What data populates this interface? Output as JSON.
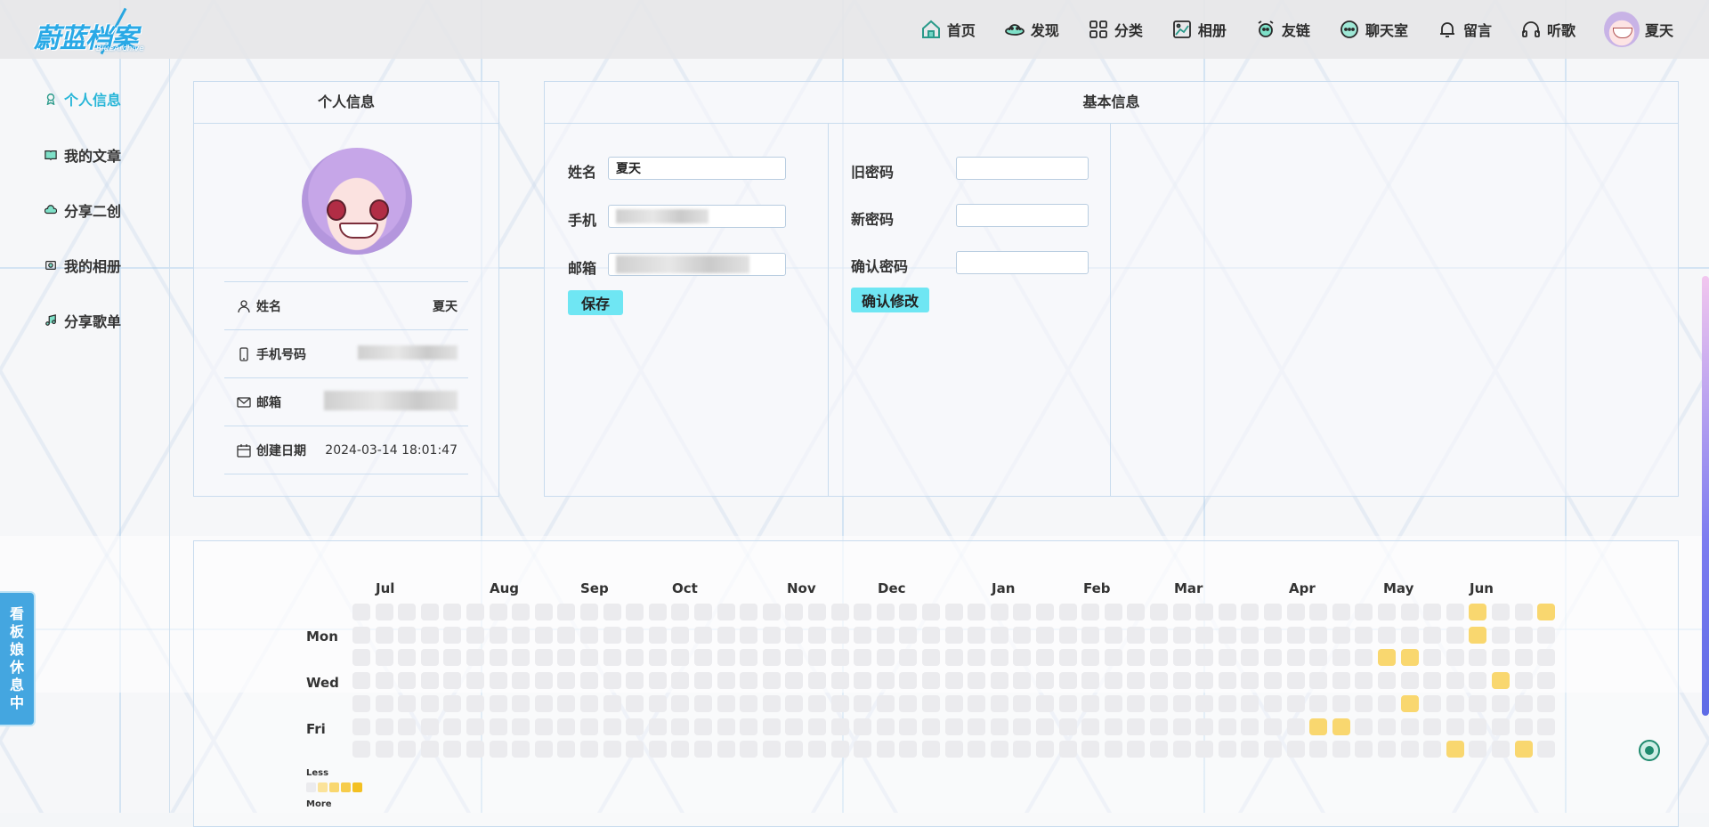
{
  "app": {
    "logo_main": "蔚蓝档案",
    "logo_sub": "BlueArchive"
  },
  "nav": {
    "items": [
      {
        "label": "首页",
        "icon": "home-icon"
      },
      {
        "label": "发现",
        "icon": "ufo-icon"
      },
      {
        "label": "分类",
        "icon": "grid-icon"
      },
      {
        "label": "相册",
        "icon": "image-icon"
      },
      {
        "label": "友链",
        "icon": "alarm-clock-icon"
      },
      {
        "label": "聊天室",
        "icon": "chat-icon"
      },
      {
        "label": "留言",
        "icon": "bell-icon"
      },
      {
        "label": "听歌",
        "icon": "headphones-icon"
      }
    ],
    "user_name": "夏天"
  },
  "sidebar": {
    "items": [
      {
        "label": "个人信息",
        "active": true,
        "icon": "user-badge-icon"
      },
      {
        "label": "我的文章",
        "active": false,
        "icon": "book-icon"
      },
      {
        "label": "分享二创",
        "active": false,
        "icon": "cloud-icon"
      },
      {
        "label": "我的相册",
        "active": false,
        "icon": "album-icon"
      },
      {
        "label": "分享歌单",
        "active": false,
        "icon": "music-note-icon"
      }
    ]
  },
  "rest_tab": {
    "label": "看板娘休息中"
  },
  "profile": {
    "title": "个人信息",
    "rows": [
      {
        "label": "姓名",
        "value": "夏天",
        "icon": "user-icon"
      },
      {
        "label": "手机号码",
        "value": "",
        "icon": "phone-icon"
      },
      {
        "label": "邮箱",
        "value": "",
        "icon": "mail-icon"
      },
      {
        "label": "创建日期",
        "value": "2024-03-14 18:01:47",
        "icon": "calendar-icon"
      }
    ]
  },
  "basic": {
    "title": "基本信息",
    "name_label": "姓名",
    "name_value": "夏天",
    "phone_label": "手机",
    "email_label": "邮箱",
    "save_label": "保存",
    "old_pw_label": "旧密码",
    "new_pw_label": "新密码",
    "confirm_pw_label": "确认密码",
    "confirm_button": "确认修改"
  },
  "heatmap": {
    "months": [
      "Jul",
      "Aug",
      "Sep",
      "Oct",
      "Nov",
      "Dec",
      "Jan",
      "Feb",
      "Mar",
      "Apr",
      "May",
      "Jun"
    ],
    "day_labels": [
      "Mon",
      "Wed",
      "Fri"
    ],
    "legend_less": "Less",
    "legend_more": "More",
    "weeks": 53,
    "days": 7,
    "active_cells": [
      {
        "week": 49,
        "day": 0,
        "level": 2
      },
      {
        "week": 49,
        "day": 1,
        "level": 2
      },
      {
        "week": 52,
        "day": 0,
        "level": 2
      },
      {
        "week": 45,
        "day": 2,
        "level": 2
      },
      {
        "week": 46,
        "day": 2,
        "level": 2
      },
      {
        "week": 50,
        "day": 3,
        "level": 2
      },
      {
        "week": 46,
        "day": 4,
        "level": 2
      },
      {
        "week": 42,
        "day": 5,
        "level": 2
      },
      {
        "week": 43,
        "day": 5,
        "level": 2
      },
      {
        "week": 48,
        "day": 6,
        "level": 2
      },
      {
        "week": 51,
        "day": 6,
        "level": 2
      }
    ]
  }
}
